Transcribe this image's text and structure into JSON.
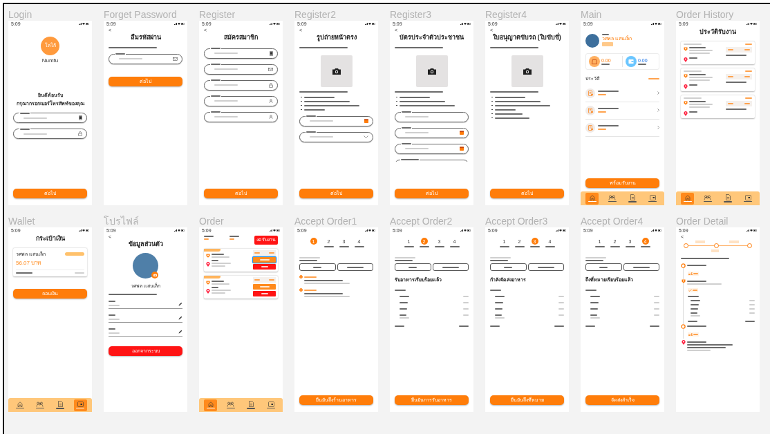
{
  "frames": [
    {
      "title": "Login",
      "screen": {
        "time": "5:09",
        "body": [
          {
            "kind": "logo",
            "text": "โลโก้",
            "brand": "Numfu"
          },
          {
            "kind": "subheading",
            "text": "ยินดีต้อนรับ"
          },
          {
            "kind": "subheading",
            "text": "กรุณากรอกเบอร์โทรศัพท์ของคุณ"
          },
          {
            "kind": "phone_field"
          },
          {
            "kind": "password_field"
          }
        ],
        "footer_button": {
          "kind": "button",
          "label": "ต่อไป"
        }
      }
    },
    {
      "title": "Forget Password",
      "screen": {
        "time": "5:09",
        "body": [
          {
            "kind": "back",
            "glyph": "<"
          },
          {
            "kind": "heading",
            "text": "ลืมรหัสผ่าน"
          },
          {
            "kind": "caption"
          },
          {
            "kind": "email_field"
          },
          {
            "kind": "button",
            "label": "ต่อไป"
          }
        ]
      }
    },
    {
      "title": "Register",
      "screen": {
        "time": "5:09",
        "body": [
          {
            "kind": "back",
            "glyph": "<"
          },
          {
            "kind": "heading",
            "text": "สมัครสมาชิก"
          },
          {
            "kind": "phone_field"
          },
          {
            "kind": "email_field"
          },
          {
            "kind": "password_field"
          },
          {
            "kind": "name_field"
          },
          {
            "kind": "name_field"
          }
        ],
        "footer_button": {
          "kind": "button",
          "label": "ต่อไป"
        }
      }
    },
    {
      "title": "Register2",
      "screen": {
        "time": "5:09",
        "body": [
          {
            "kind": "back",
            "glyph": "<"
          },
          {
            "kind": "heading",
            "text": "รูปถ่ายหน้าตรง"
          },
          {
            "kind": "caption"
          },
          {
            "kind": "upload"
          },
          {
            "kind": "caption"
          },
          {
            "kind": "bullets",
            "items": [
              {
                "kind": "bullet"
              },
              {
                "kind": "bullet"
              },
              {
                "kind": "bullet"
              },
              {
                "kind": "bullet"
              }
            ]
          },
          {
            "kind": "date_field"
          },
          {
            "kind": "select_field"
          }
        ],
        "footer_button": {
          "kind": "button",
          "label": "ต่อไป"
        }
      }
    },
    {
      "title": "Register3",
      "screen": {
        "time": "5:09",
        "body": [
          {
            "kind": "back",
            "glyph": "<"
          },
          {
            "kind": "heading",
            "text": "บัตรประจำตัวประชาชน"
          },
          {
            "kind": "caption"
          },
          {
            "kind": "upload"
          },
          {
            "kind": "caption"
          },
          {
            "kind": "bullets",
            "items": [
              {
                "kind": "bullet"
              },
              {
                "kind": "bullet"
              },
              {
                "kind": "bullet"
              }
            ]
          },
          {
            "kind": "text_field"
          },
          {
            "kind": "date_field"
          },
          {
            "kind": "date_field"
          },
          {
            "kind": "cut_field"
          }
        ],
        "footer_button": {
          "kind": "button",
          "label": "ต่อไป"
        }
      }
    },
    {
      "title": "Register4",
      "screen": {
        "time": "5:09",
        "body": [
          {
            "kind": "back",
            "glyph": "<"
          },
          {
            "kind": "heading",
            "text": "ใบอนุญาตขับรถ (ใบขับขี่)"
          },
          {
            "kind": "caption"
          },
          {
            "kind": "upload"
          },
          {
            "kind": "caption"
          },
          {
            "kind": "bullets",
            "items": [
              {
                "kind": "bullet"
              },
              {
                "kind": "bullet"
              },
              {
                "kind": "bullet"
              },
              {
                "kind": "bullet"
              },
              {
                "kind": "bullet"
              },
              {
                "kind": "bullet"
              }
            ]
          }
        ],
        "footer_button": {
          "kind": "button",
          "label": "ต่อไป"
        }
      }
    },
    {
      "title": "Main",
      "screen": {
        "time": "5:09",
        "body": [
          {
            "kind": "greeting",
            "name": "วศพล แสนเล็ก"
          },
          {
            "kind": "stats",
            "items": [
              {
                "value": "0.00"
              },
              {
                "value": "0.00"
              }
            ]
          },
          {
            "kind": "section",
            "title": "ประวัติ"
          },
          {
            "kind": "history_item"
          },
          {
            "kind": "history_item"
          },
          {
            "kind": "history_item"
          }
        ],
        "footer_button": {
          "kind": "button",
          "label": "พร้อมรับงาน"
        },
        "nav": [
          {
            "selected": true
          },
          {
            "selected": false
          },
          {
            "selected": false
          },
          {
            "selected": false
          }
        ]
      }
    },
    {
      "title": "Order History",
      "screen": {
        "time": "5:09",
        "body": [
          {
            "kind": "heading",
            "text": "ประวัติรับงาน"
          },
          {
            "kind": "history_card"
          },
          {
            "kind": "history_card"
          },
          {
            "kind": "history_card"
          }
        ],
        "nav": [
          {
            "selected": true
          },
          {
            "selected": false
          },
          {
            "selected": false
          },
          {
            "selected": false
          }
        ]
      }
    },
    {
      "title": "Wallet",
      "screen": {
        "time": "5:09",
        "body": [
          {
            "kind": "heading",
            "text": "กระเป๋าเงิน"
          },
          {
            "kind": "wallet_card",
            "name": "วศพล แสนเล็ก",
            "amount": "56.07 บาท"
          },
          {
            "kind": "button",
            "label": "ถอนเงิน"
          }
        ],
        "nav": [
          {
            "selected": false
          },
          {
            "selected": false
          },
          {
            "selected": false
          },
          {
            "selected": true
          }
        ]
      }
    },
    {
      "title": "โปรไฟล์",
      "screen": {
        "time": "5:09",
        "body": [
          {
            "kind": "back",
            "glyph": "<"
          },
          {
            "kind": "heading",
            "text": "ข้อมูลส่วนตัว"
          },
          {
            "kind": "avatar",
            "name": "วศพล แสนเล็ก"
          },
          {
            "kind": "caption"
          },
          {
            "kind": "edit_field"
          },
          {
            "kind": "edit_field"
          },
          {
            "kind": "edit_field"
          },
          {
            "kind": "danger_button",
            "label": "ออกจากระบบ"
          }
        ]
      }
    },
    {
      "title": "Order",
      "screen": {
        "time": "5:09",
        "body": [
          {
            "kind": "order_summary",
            "button": "งดรับงาน"
          },
          {
            "kind": "job_card",
            "accept_focused": true
          },
          {
            "kind": "job_card",
            "accept_focused": false
          }
        ],
        "nav": [
          {
            "selected": true
          },
          {
            "selected": false
          },
          {
            "selected": false
          },
          {
            "selected": false
          }
        ]
      }
    },
    {
      "title": "Accept Order1",
      "screen": {
        "time": "5:09",
        "body": [
          {
            "kind": "stepper",
            "steps": [
              {
                "number": "1",
                "selected": true
              },
              {
                "number": "2",
                "selected": false
              },
              {
                "number": "3",
                "selected": false
              },
              {
                "number": "4",
                "selected": false
              }
            ]
          },
          {
            "kind": "order_meta"
          },
          {
            "kind": "radio",
            "selected": true
          },
          {
            "kind": "radio",
            "selected": true
          }
        ],
        "footer_button": {
          "kind": "button",
          "label": "ยืนยันถึงร้านอาหาร"
        }
      }
    },
    {
      "title": "Accept Order2",
      "screen": {
        "time": "5:09",
        "body": [
          {
            "kind": "stepper",
            "steps": [
              {
                "number": "1",
                "selected": false
              },
              {
                "number": "2",
                "selected": true
              },
              {
                "number": "3",
                "selected": false
              },
              {
                "number": "4",
                "selected": false
              }
            ]
          },
          {
            "kind": "order_meta"
          },
          {
            "kind": "status_title",
            "text": "รับอาหารเรียบร้อยแล้ว"
          },
          {
            "kind": "order_items"
          }
        ],
        "footer_button": {
          "kind": "button",
          "label": "ยืนยันการรับอาหาร"
        }
      }
    },
    {
      "title": "Accept Order3",
      "screen": {
        "time": "5:09",
        "body": [
          {
            "kind": "stepper",
            "steps": [
              {
                "number": "1",
                "selected": false
              },
              {
                "number": "2",
                "selected": false
              },
              {
                "number": "3",
                "selected": true
              },
              {
                "number": "4",
                "selected": false
              }
            ]
          },
          {
            "kind": "order_meta"
          },
          {
            "kind": "status_title",
            "text": "กำลังจัดส่งอาหาร"
          },
          {
            "kind": "order_items"
          }
        ],
        "footer_button": {
          "kind": "button",
          "label": "ยืนยันถึงที่หมาย"
        }
      }
    },
    {
      "title": "Accept Order4",
      "screen": {
        "time": "5:09",
        "body": [
          {
            "kind": "stepper",
            "steps": [
              {
                "number": "1",
                "selected": false
              },
              {
                "number": "2",
                "selected": false
              },
              {
                "number": "3",
                "selected": false
              },
              {
                "number": "4",
                "selected": true
              }
            ]
          },
          {
            "kind": "order_meta"
          },
          {
            "kind": "status_title",
            "text": "ถึงที่หมายเรียบร้อยแล้ว"
          },
          {
            "kind": "order_items"
          }
        ],
        "footer_button": {
          "kind": "button",
          "label": "จัดส่งสำเร็จ"
        }
      }
    },
    {
      "title": "Order Detail",
      "screen": {
        "time": "5:09",
        "body": [
          {
            "kind": "back",
            "glyph": "<"
          },
          {
            "kind": "route"
          },
          {
            "kind": "caption"
          },
          {
            "kind": "timeline",
            "entries": [
              {
                "kind": "start_stop"
              },
              {
                "kind": "eta",
                "done": false
              },
              {
                "kind": "store_stop"
              },
              {
                "kind": "eta",
                "done": true
              },
              {
                "kind": "order_items"
              },
              {
                "kind": "pickup_stop"
              },
              {
                "kind": "eta",
                "done": false
              },
              {
                "kind": "destination_stop"
              }
            ]
          }
        ]
      }
    }
  ]
}
